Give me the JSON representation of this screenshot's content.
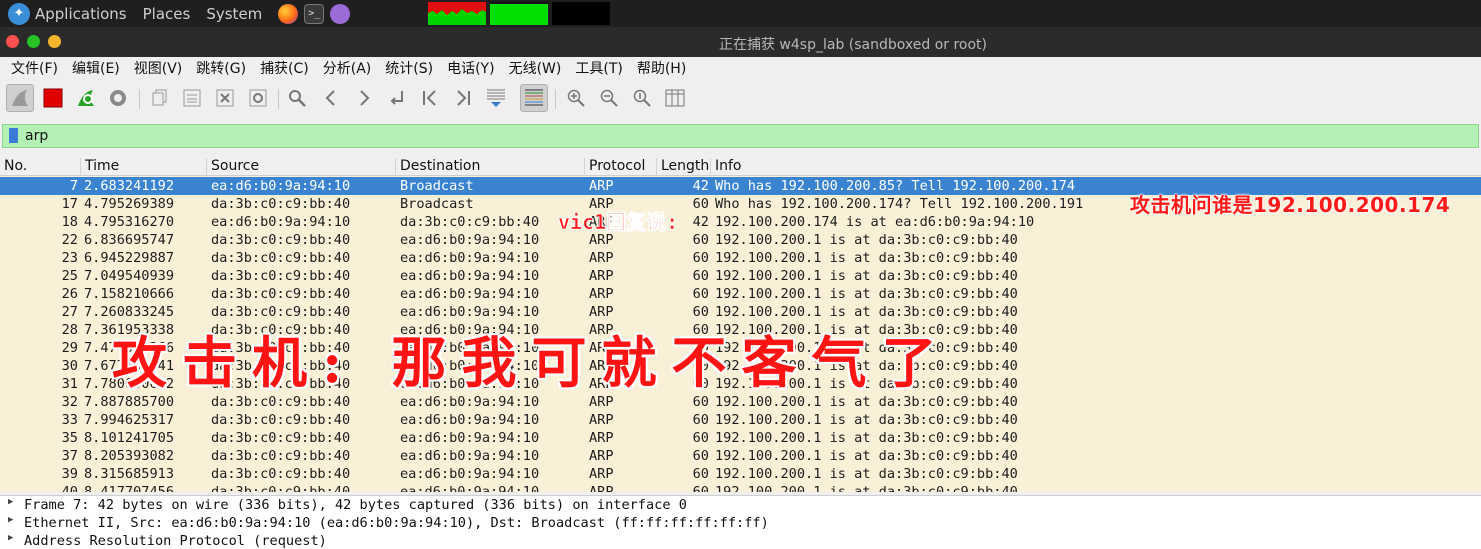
{
  "panel": {
    "applications": "Applications",
    "places": "Places",
    "system": "System"
  },
  "window": {
    "title": "正在捕获 w4sp_lab (sandboxed or root)"
  },
  "menubar": [
    "文件(F)",
    "编辑(E)",
    "视图(V)",
    "跳转(G)",
    "捕获(C)",
    "分析(A)",
    "统计(S)",
    "电话(Y)",
    "无线(W)",
    "工具(T)",
    "帮助(H)"
  ],
  "filter": {
    "value": "arp"
  },
  "columns": [
    "No.",
    "Time",
    "Source",
    "Destination",
    "Protocol",
    "Length",
    "Info"
  ],
  "packets": [
    {
      "no": "7",
      "time": "2.683241192",
      "src": "ea:d6:b0:9a:94:10",
      "dst": "Broadcast",
      "proto": "ARP",
      "len": "42",
      "info": "Who has 192.100.200.85? Tell 192.100.200.174",
      "selected": true
    },
    {
      "no": "17",
      "time": "4.795269389",
      "src": "da:3b:c0:c9:bb:40",
      "dst": "Broadcast",
      "proto": "ARP",
      "len": "60",
      "info": "Who has 192.100.200.174? Tell 192.100.200.191"
    },
    {
      "no": "18",
      "time": "4.795316270",
      "src": "ea:d6:b0:9a:94:10",
      "dst": "da:3b:c0:c9:bb:40",
      "proto": "ARP",
      "len": "42",
      "info": "192.100.200.174 is at ea:d6:b0:9a:94:10"
    },
    {
      "no": "22",
      "time": "6.836695747",
      "src": "da:3b:c0:c9:bb:40",
      "dst": "ea:d6:b0:9a:94:10",
      "proto": "ARP",
      "len": "60",
      "info": "192.100.200.1 is at da:3b:c0:c9:bb:40"
    },
    {
      "no": "23",
      "time": "6.945229887",
      "src": "da:3b:c0:c9:bb:40",
      "dst": "ea:d6:b0:9a:94:10",
      "proto": "ARP",
      "len": "60",
      "info": "192.100.200.1 is at da:3b:c0:c9:bb:40"
    },
    {
      "no": "25",
      "time": "7.049540939",
      "src": "da:3b:c0:c9:bb:40",
      "dst": "ea:d6:b0:9a:94:10",
      "proto": "ARP",
      "len": "60",
      "info": "192.100.200.1 is at da:3b:c0:c9:bb:40"
    },
    {
      "no": "26",
      "time": "7.158210666",
      "src": "da:3b:c0:c9:bb:40",
      "dst": "ea:d6:b0:9a:94:10",
      "proto": "ARP",
      "len": "60",
      "info": "192.100.200.1 is at da:3b:c0:c9:bb:40"
    },
    {
      "no": "27",
      "time": "7.260833245",
      "src": "da:3b:c0:c9:bb:40",
      "dst": "ea:d6:b0:9a:94:10",
      "proto": "ARP",
      "len": "60",
      "info": "192.100.200.1 is at da:3b:c0:c9:bb:40"
    },
    {
      "no": "28",
      "time": "7.361953338",
      "src": "da:3b:c0:c9:bb:40",
      "dst": "ea:d6:b0:9a:94:10",
      "proto": "ARP",
      "len": "60",
      "info": "192.100.200.1 is at da:3b:c0:c9:bb:40"
    },
    {
      "no": "29",
      "time": "7.474033366",
      "src": "da:3b:c0:c9:bb:40",
      "dst": "ea:d6:b0:9a:94:10",
      "proto": "ARP",
      "len": "60",
      "info": "192.100.200.1 is at da:3b:c0:c9:bb:40"
    },
    {
      "no": "30",
      "time": "7.677136641",
      "src": "da:3b:c0:c9:bb:40",
      "dst": "ea:d6:b0:9a:94:10",
      "proto": "ARP",
      "len": "60",
      "info": "192.100.200.1 is at da:3b:c0:c9:bb:40"
    },
    {
      "no": "31",
      "time": "7.780000622",
      "src": "da:3b:c0:c9:bb:40",
      "dst": "ea:d6:b0:9a:94:10",
      "proto": "ARP",
      "len": "60",
      "info": "192.100.200.1 is at da:3b:c0:c9:bb:40"
    },
    {
      "no": "32",
      "time": "7.887885700",
      "src": "da:3b:c0:c9:bb:40",
      "dst": "ea:d6:b0:9a:94:10",
      "proto": "ARP",
      "len": "60",
      "info": "192.100.200.1 is at da:3b:c0:c9:bb:40"
    },
    {
      "no": "33",
      "time": "7.994625317",
      "src": "da:3b:c0:c9:bb:40",
      "dst": "ea:d6:b0:9a:94:10",
      "proto": "ARP",
      "len": "60",
      "info": "192.100.200.1 is at da:3b:c0:c9:bb:40"
    },
    {
      "no": "35",
      "time": "8.101241705",
      "src": "da:3b:c0:c9:bb:40",
      "dst": "ea:d6:b0:9a:94:10",
      "proto": "ARP",
      "len": "60",
      "info": "192.100.200.1 is at da:3b:c0:c9:bb:40"
    },
    {
      "no": "37",
      "time": "8.205393082",
      "src": "da:3b:c0:c9:bb:40",
      "dst": "ea:d6:b0:9a:94:10",
      "proto": "ARP",
      "len": "60",
      "info": "192.100.200.1 is at da:3b:c0:c9:bb:40"
    },
    {
      "no": "39",
      "time": "8.315685913",
      "src": "da:3b:c0:c9:bb:40",
      "dst": "ea:d6:b0:9a:94:10",
      "proto": "ARP",
      "len": "60",
      "info": "192.100.200.1 is at da:3b:c0:c9:bb:40"
    },
    {
      "no": "40",
      "time": "8.417707456",
      "src": "da:3b:c0:c9:bb:40",
      "dst": "ea:d6:b0:9a:94:10",
      "proto": "ARP",
      "len": "60",
      "info": "192.100.200.1 is at da:3b:c0:c9:bb:40"
    }
  ],
  "details": [
    "Frame 7: 42 bytes on wire (336 bits), 42 bytes captured (336 bits) on interface 0",
    "Ethernet II, Src: ea:d6:b0:9a:94:10 (ea:d6:b0:9a:94:10), Dst: Broadcast (ff:ff:ff:ff:ff:ff)",
    "Address Resolution Protocol (request)"
  ],
  "annotations": {
    "victim_reply": "vic1回复说:",
    "attacker_question": "攻击机问谁是192.100.200.174",
    "attacker_rude": "攻击机: 那我可就不客气了"
  },
  "colors": {
    "selected_row": "#3a83d1",
    "row_bg": "#faf0d7",
    "filter_bg": "#b4f1b4",
    "annotation": "#ff1a1a"
  }
}
